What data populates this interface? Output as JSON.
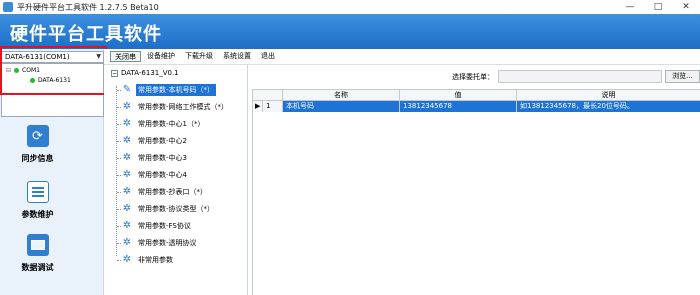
{
  "window": {
    "title": "平升硬件平台工具软件 1.2.7.5 Beta10",
    "minimize": "—",
    "maximize": "□",
    "close": "✕"
  },
  "banner": {
    "title": "硬件平台工具软件"
  },
  "port_selector": {
    "selected": "DATA-6131(COM1)",
    "tree": {
      "port": "COM1",
      "device": "DATA-6131"
    }
  },
  "toolbar": {
    "items": [
      "关闭串",
      "设备维护",
      "下载升级",
      "系统设置",
      "退出"
    ]
  },
  "sidebar": {
    "items": [
      {
        "label": "同步信息",
        "icon": "sync-icon"
      },
      {
        "label": "参数维护",
        "icon": "parameters-icon"
      },
      {
        "label": "数据调试",
        "icon": "monitor-icon"
      }
    ]
  },
  "param_tree": {
    "root": "DATA-6131_V0.1",
    "nodes": [
      {
        "label": "常用参数-本机号码（*）",
        "selected": true
      },
      {
        "label": "常用参数-网络工作模式（*）",
        "selected": false
      },
      {
        "label": "常用参数-中心1（*）",
        "selected": false
      },
      {
        "label": "常用参数-中心2",
        "selected": false
      },
      {
        "label": "常用参数-中心3",
        "selected": false
      },
      {
        "label": "常用参数-中心4",
        "selected": false
      },
      {
        "label": "常用参数-抄表口（*）",
        "selected": false
      },
      {
        "label": "常用参数-协议类型（*）",
        "selected": false
      },
      {
        "label": "常用参数-FS协议",
        "selected": false
      },
      {
        "label": "常用参数-透明协议",
        "selected": false
      },
      {
        "label": "非常用参数",
        "selected": false
      }
    ]
  },
  "delegate": {
    "label": "选择委托单：",
    "value": "",
    "browse_button": "浏览..."
  },
  "grid": {
    "columns": [
      "名称",
      "值",
      "说明"
    ],
    "rows": [
      {
        "indicator": "▶",
        "index": "1",
        "name": "本机号码",
        "value": "13812345678",
        "description": "如13812345678，最长20位号码。"
      }
    ]
  }
}
